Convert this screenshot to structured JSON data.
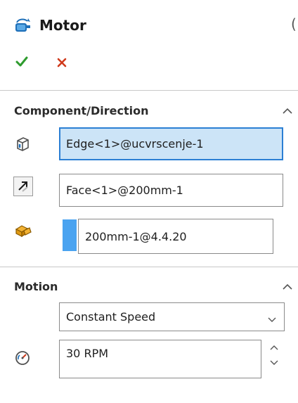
{
  "header": {
    "title": "Motor",
    "title_icon": "motor-icon",
    "ok_icon": "checkmark-icon",
    "cancel_icon": "close-icon"
  },
  "component_direction": {
    "title": "Component/Direction",
    "edge_field": {
      "value": "Edge<1>@ucvrscenje-1",
      "icon": "edge-component-icon"
    },
    "face_field": {
      "value": "Face<1>@200mm-1",
      "icon": "reverse-direction-icon"
    },
    "component_field": {
      "value": "200mm-1@4.4.20",
      "icon": "component-to-move-icon"
    }
  },
  "motion": {
    "title": "Motion",
    "type_select": {
      "value": "Constant Speed"
    },
    "speed_field": {
      "value": "30 RPM",
      "icon": "speedometer-icon"
    }
  },
  "colors": {
    "selected_bg": "#cce4f7",
    "selected_border": "#2b7fd4",
    "ok_green": "#2e9b2e",
    "cancel_red": "#d03a1c",
    "swatch_blue": "#4aa3f0"
  }
}
